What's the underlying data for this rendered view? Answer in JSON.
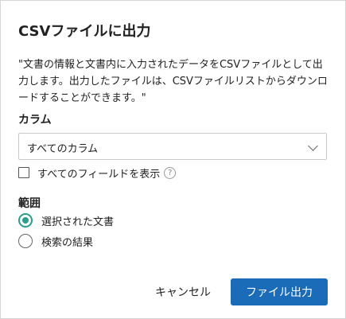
{
  "dialog": {
    "title": "CSVファイルに出力",
    "description": "\"文書の情報と文書内に入力されたデータをCSVファイルとして出力します。出力したファイルは、CSVファイルリストからダウンロードすることができます。\"",
    "column_section": {
      "label": "カラム",
      "select_value": "すべてのカラム",
      "select_icon": "chevron-down-icon"
    },
    "show_all_fields": {
      "label": "すべてのフィールドを表示",
      "checked": false,
      "help_icon": "help-icon",
      "help_glyph": "?"
    },
    "scope_section": {
      "label": "範囲",
      "options": [
        {
          "label": "選択された文書",
          "selected": true
        },
        {
          "label": "検索の結果",
          "selected": false
        }
      ]
    },
    "buttons": {
      "cancel_label": "キャンセル",
      "export_label": "ファイル出力"
    }
  },
  "colors": {
    "primary": "#1a6bb8",
    "radio_selected": "#2a9d8f",
    "border": "#d4d4d4"
  }
}
